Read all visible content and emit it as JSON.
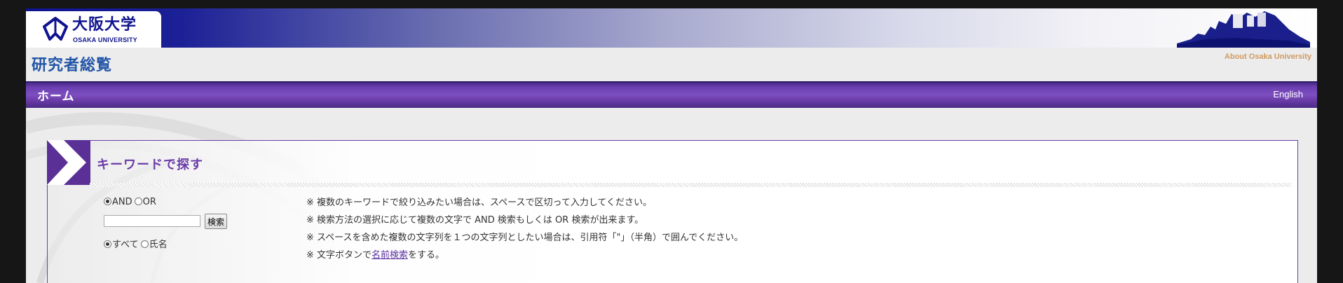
{
  "header": {
    "logo_jp": "大阪大学",
    "logo_en": "OSAKA UNIVERSITY",
    "site_title": "研究者総覧",
    "about_link": "About Osaka University",
    "brand_color": "#10138e"
  },
  "nav": {
    "home": "ホーム",
    "english": "English",
    "accent_color": "#6b3ca8"
  },
  "search": {
    "title": "キーワードで探す",
    "mode": {
      "options": [
        "AND",
        "OR"
      ],
      "selected": "AND"
    },
    "keyword_value": "",
    "button_label": "検索",
    "scope": {
      "options": [
        "すべて",
        "氏名"
      ],
      "selected": "すべて"
    },
    "notes": [
      "※ 複数のキーワードで絞り込みたい場合は、スペースで区切って入力してください。",
      "※ 検索方法の選択に応じて複数の文字で AND 検索もしくは OR 検索が出来ます。",
      "※ スペースを含めた複数の文字列を１つの文字列としたい場合は、引用符「\"」（半角）で囲んでください。"
    ],
    "last_note": {
      "prefix": "※ 文字ボタンで",
      "link": "名前検索",
      "suffix": "をする。"
    }
  }
}
